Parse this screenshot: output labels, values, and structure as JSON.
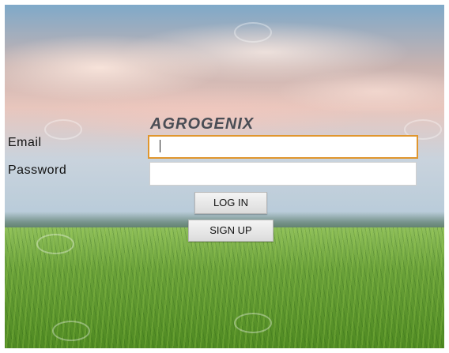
{
  "app": {
    "title": "AGROGENIX"
  },
  "form": {
    "email_label": "Email",
    "email_value": "",
    "password_label": "Password",
    "password_value": ""
  },
  "buttons": {
    "login_label": "LOG IN",
    "signup_label": "SIGN UP"
  },
  "colors": {
    "focus_border": "#e0962e",
    "title_color": "#4a4d55"
  }
}
